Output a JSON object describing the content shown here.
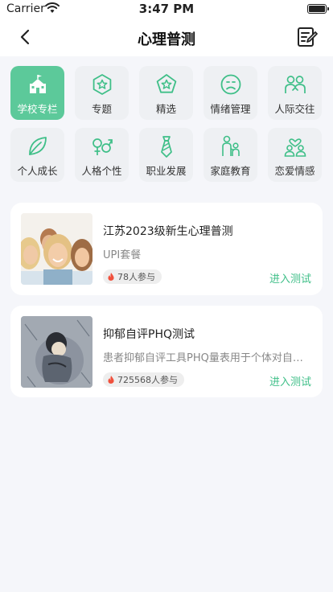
{
  "status": {
    "carrier": "Carrier",
    "time": "3:47 PM"
  },
  "nav": {
    "title": "心理普测",
    "back_icon": "chevron-left-icon",
    "edit_icon": "edit-note-icon"
  },
  "colors": {
    "accent": "#5cc99a",
    "accent_text": "#3fbf88",
    "tile_bg": "#eef0f3",
    "page_bg": "#f5f6fa"
  },
  "categories": [
    {
      "label": "学校专栏",
      "icon": "school-icon",
      "active": true
    },
    {
      "label": "专题",
      "icon": "hexagon-star-icon",
      "active": false
    },
    {
      "label": "精选",
      "icon": "pentagon-star-icon",
      "active": false
    },
    {
      "label": "情绪管理",
      "icon": "sad-face-icon",
      "active": false
    },
    {
      "label": "人际交往",
      "icon": "people-icon",
      "active": false
    },
    {
      "label": "个人成长",
      "icon": "leaf-icon",
      "active": false
    },
    {
      "label": "人格个性",
      "icon": "gender-icon",
      "active": false
    },
    {
      "label": "职业发展",
      "icon": "tie-icon",
      "active": false
    },
    {
      "label": "家庭教育",
      "icon": "family-icon",
      "active": false
    },
    {
      "label": "恋爱情感",
      "icon": "couple-heart-icon",
      "active": false
    }
  ],
  "tests": [
    {
      "title": "江苏2023级新生心理普测",
      "subtitle": "UPI套餐",
      "participants": "78人参与",
      "action": "进入测试"
    },
    {
      "title": "抑郁自评PHQ测试",
      "subtitle": "患者抑郁自评工具PHQ量表用于个体对自我抑郁状态的评估",
      "participants": "725568人参与",
      "action": "进入测试"
    }
  ]
}
